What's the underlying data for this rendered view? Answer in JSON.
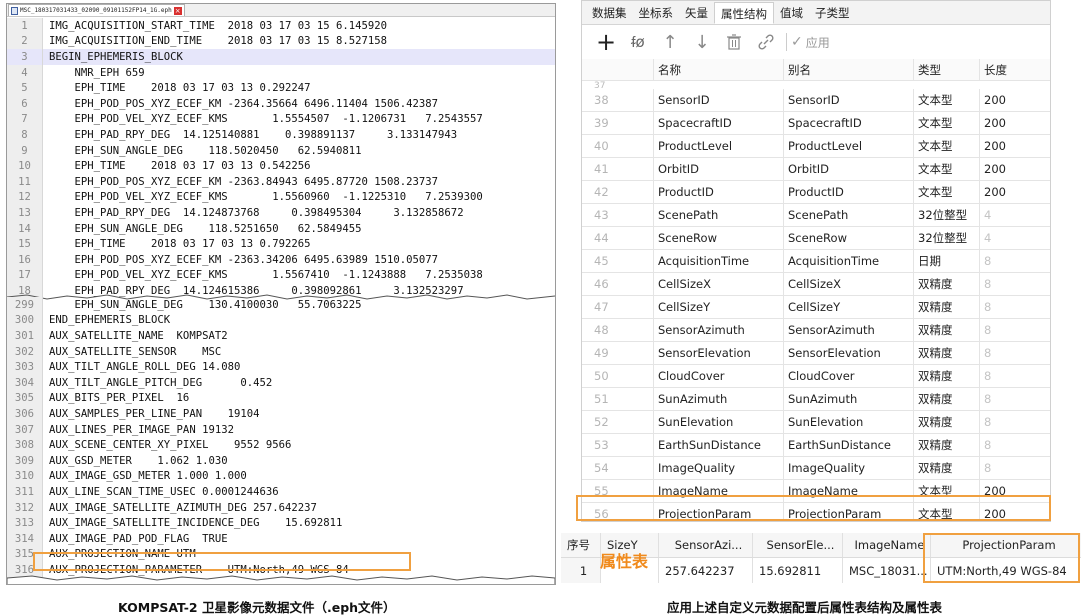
{
  "editor": {
    "tab_title": "MSC_180317031433_02090_09101152FP14_1G.eph",
    "top_lines": [
      {
        "n": "1",
        "t": "IMG_ACQUISITION_START_TIME  2018 03 17 03 15 6.145920"
      },
      {
        "n": "2",
        "t": "IMG_ACQUISITION_END_TIME    2018 03 17 03 15 8.527158"
      },
      {
        "n": "3",
        "t": "BEGIN_EPHEMERIS_BLOCK"
      },
      {
        "n": "4",
        "t": "    NMR_EPH 659"
      },
      {
        "n": "5",
        "t": "    EPH_TIME    2018 03 17 03 13 0.292247"
      },
      {
        "n": "6",
        "t": "    EPH_POD_POS_XYZ_ECEF_KM -2364.35664 6496.11404 1506.42387"
      },
      {
        "n": "7",
        "t": "    EPH_POD_VEL_XYZ_ECEF_KMS       1.5554507  -1.1206731   7.2543557"
      },
      {
        "n": "8",
        "t": "    EPH_PAD_RPY_DEG  14.125140881    0.398891137     3.133147943"
      },
      {
        "n": "9",
        "t": "    EPH_SUN_ANGLE_DEG    118.5020450   62.5940811"
      },
      {
        "n": "10",
        "t": "    EPH_TIME    2018 03 17 03 13 0.542256"
      },
      {
        "n": "11",
        "t": "    EPH_POD_POS_XYZ_ECEF_KM -2363.84943 6495.87720 1508.23737"
      },
      {
        "n": "12",
        "t": "    EPH_POD_VEL_XYZ_ECEF_KMS       1.5560960  -1.1225310   7.2539300"
      },
      {
        "n": "13",
        "t": "    EPH_PAD_RPY_DEG  14.124873768     0.398495304     3.132858672"
      },
      {
        "n": "14",
        "t": "    EPH_SUN_ANGLE_DEG    118.5251650   62.5849455"
      },
      {
        "n": "15",
        "t": "    EPH_TIME    2018 03 17 03 13 0.792265"
      },
      {
        "n": "16",
        "t": "    EPH_POD_POS_XYZ_ECEF_KM -2363.34206 6495.63989 1510.05077"
      },
      {
        "n": "17",
        "t": "    EPH_POD_VEL_XYZ_ECEF_KMS       1.5567410  -1.1243888   7.2535038"
      },
      {
        "n": "18",
        "t": "    EPH_PAD_RPY_DEG  14.124615386     0.398092861     3.132523297"
      }
    ],
    "bottom_lines": [
      {
        "n": "299",
        "t": "    EPH_SUN_ANGLE_DEG    130.4100030   55.7063225"
      },
      {
        "n": "300",
        "t": "END_EPHEMERIS_BLOCK"
      },
      {
        "n": "301",
        "t": "AUX_SATELLITE_NAME  KOMPSAT2"
      },
      {
        "n": "302",
        "t": "AUX_SATELLITE_SENSOR    MSC"
      },
      {
        "n": "303",
        "t": "AUX_TILT_ANGLE_ROLL_DEG 14.080"
      },
      {
        "n": "304",
        "t": "AUX_TILT_ANGLE_PITCH_DEG      0.452"
      },
      {
        "n": "305",
        "t": "AUX_BITS_PER_PIXEL  16"
      },
      {
        "n": "306",
        "t": "AUX_SAMPLES_PER_LINE_PAN    19104"
      },
      {
        "n": "307",
        "t": "AUX_LINES_PER_IMAGE_PAN 19132"
      },
      {
        "n": "308",
        "t": "AUX_SCENE_CENTER_XY_PIXEL    9552 9566"
      },
      {
        "n": "309",
        "t": "AUX_GSD_METER    1.062 1.030"
      },
      {
        "n": "310",
        "t": "AUX_IMAGE_GSD_METER 1.000 1.000"
      },
      {
        "n": "311",
        "t": "AUX_LINE_SCAN_TIME_USEC 0.0001244636"
      },
      {
        "n": "312",
        "t": "AUX_IMAGE_SATELLITE_AZIMUTH_DEG 257.642237"
      },
      {
        "n": "313",
        "t": "AUX_IMAGE_SATELLITE_INCIDENCE_DEG    15.692811"
      },
      {
        "n": "314",
        "t": "AUX_IMAGE_PAD_POD_FLAG  TRUE"
      },
      {
        "n": "315",
        "t": "AUX_PROJECTION_NAME UTM"
      },
      {
        "n": "316",
        "t": "AUX_PROJECTION_PARAMETER    UTM:North,49 WGS-84"
      }
    ]
  },
  "captions": {
    "left": "KOMPSAT-2 卫星影像元数据文件（.eph文件）",
    "right": "应用上述自定义元数据配置后属性表结构及属性表"
  },
  "panel": {
    "tabs": [
      "数据集",
      "坐标系",
      "矢量",
      "属性结构",
      "值域",
      "子类型"
    ],
    "apply_label": "应用",
    "headers": {
      "name": "名称",
      "alias": "别名",
      "type": "类型",
      "length": "长度"
    },
    "cut_index": "37",
    "rows": [
      {
        "idx": "38",
        "name": "SensorID",
        "alias": "SensorID",
        "type": "文本型",
        "len": "200",
        "dim": false
      },
      {
        "idx": "39",
        "name": "SpacecraftID",
        "alias": "SpacecraftID",
        "type": "文本型",
        "len": "200",
        "dim": false
      },
      {
        "idx": "40",
        "name": "ProductLevel",
        "alias": "ProductLevel",
        "type": "文本型",
        "len": "200",
        "dim": false
      },
      {
        "idx": "41",
        "name": "OrbitID",
        "alias": "OrbitID",
        "type": "文本型",
        "len": "200",
        "dim": false
      },
      {
        "idx": "42",
        "name": "ProductID",
        "alias": "ProductID",
        "type": "文本型",
        "len": "200",
        "dim": false
      },
      {
        "idx": "43",
        "name": "ScenePath",
        "alias": "ScenePath",
        "type": "32位整型",
        "len": "4",
        "dim": true
      },
      {
        "idx": "44",
        "name": "SceneRow",
        "alias": "SceneRow",
        "type": "32位整型",
        "len": "4",
        "dim": true
      },
      {
        "idx": "45",
        "name": "AcquisitionTime",
        "alias": "AcquisitionTime",
        "type": "日期",
        "len": "8",
        "dim": true
      },
      {
        "idx": "46",
        "name": "CellSizeX",
        "alias": "CellSizeX",
        "type": "双精度",
        "len": "8",
        "dim": true
      },
      {
        "idx": "47",
        "name": "CellSizeY",
        "alias": "CellSizeY",
        "type": "双精度",
        "len": "8",
        "dim": true
      },
      {
        "idx": "48",
        "name": "SensorAzimuth",
        "alias": "SensorAzimuth",
        "type": "双精度",
        "len": "8",
        "dim": true
      },
      {
        "idx": "49",
        "name": "SensorElevation",
        "alias": "SensorElevation",
        "type": "双精度",
        "len": "8",
        "dim": true
      },
      {
        "idx": "50",
        "name": "CloudCover",
        "alias": "CloudCover",
        "type": "双精度",
        "len": "8",
        "dim": true
      },
      {
        "idx": "51",
        "name": "SunAzimuth",
        "alias": "SunAzimuth",
        "type": "双精度",
        "len": "8",
        "dim": true
      },
      {
        "idx": "52",
        "name": "SunElevation",
        "alias": "SunElevation",
        "type": "双精度",
        "len": "8",
        "dim": true
      },
      {
        "idx": "53",
        "name": "EarthSunDistance",
        "alias": "EarthSunDistance",
        "type": "双精度",
        "len": "8",
        "dim": true
      },
      {
        "idx": "54",
        "name": "ImageQuality",
        "alias": "ImageQuality",
        "type": "双精度",
        "len": "8",
        "dim": true
      },
      {
        "idx": "55",
        "name": "ImageName",
        "alias": "ImageName",
        "type": "文本型",
        "len": "200",
        "dim": false
      },
      {
        "idx": "56",
        "name": "ProjectionParam",
        "alias": "ProjectionParam",
        "type": "文本型",
        "len": "200",
        "dim": false
      }
    ]
  },
  "bottom_table": {
    "label": "属性表",
    "headers": [
      "序号",
      "SizeY",
      "SensorAzi...",
      "SensorEle...",
      "ImageName",
      "ProjectionParam"
    ],
    "row": [
      "1",
      "",
      "257.642237",
      "15.692811",
      "MSC_18031...",
      "UTM:North,49 WGS-84"
    ]
  }
}
